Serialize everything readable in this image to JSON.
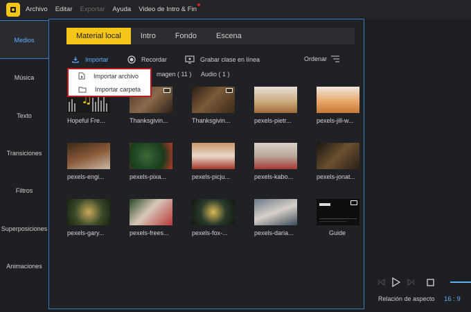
{
  "menubar": {
    "items": [
      "Archivo",
      "Editar",
      "Exportar",
      "Ayuda",
      "Video de Intro & Fin"
    ]
  },
  "sidebar": {
    "items": [
      "Medios",
      "Música",
      "Texto",
      "Transiciones",
      "Filtros",
      "Superposiciones",
      "Animaciones"
    ],
    "active": "Medios"
  },
  "tabs": [
    "Material local",
    "Intro",
    "Fondo",
    "Escena"
  ],
  "toolbar": {
    "import_label": "Importar",
    "record_label": "Recordar",
    "record_class_label": "Grabar clase en línea",
    "sort_label": "Ordenar"
  },
  "filters": {
    "image_label": "magen ( 11 )",
    "audio_label": "Audio ( 1 )"
  },
  "import_menu": {
    "items": [
      "Importar archivo",
      "Importar carpeta"
    ]
  },
  "media": [
    {
      "label": "Hopeful Fre...",
      "kind": "audio"
    },
    {
      "label": "Thanksgivin...",
      "kind": "video"
    },
    {
      "label": "Thanksgivin...",
      "kind": "video"
    },
    {
      "label": "pexels-pietr...",
      "kind": "image"
    },
    {
      "label": "pexels-jill-w...",
      "kind": "image"
    },
    {
      "label": "pexels-engi...",
      "kind": "image"
    },
    {
      "label": "pexels-pixa...",
      "kind": "image"
    },
    {
      "label": "pexels-picju...",
      "kind": "image"
    },
    {
      "label": "pexels-kabo...",
      "kind": "image"
    },
    {
      "label": "pexels-jonat...",
      "kind": "image"
    },
    {
      "label": "pexels-gary...",
      "kind": "image"
    },
    {
      "label": "pexels-frees...",
      "kind": "image"
    },
    {
      "label": "pexels-fox-...",
      "kind": "image"
    },
    {
      "label": "pexels-daria...",
      "kind": "image"
    },
    {
      "label": "Guide",
      "kind": "video"
    }
  ],
  "preview": {
    "aspect_label": "Relación de aspecto",
    "aspect_value": "16 : 9"
  },
  "colors": {
    "accent": "#f5c518",
    "highlight_blue": "#5fb0ff",
    "popup_border": "#c0161d"
  }
}
